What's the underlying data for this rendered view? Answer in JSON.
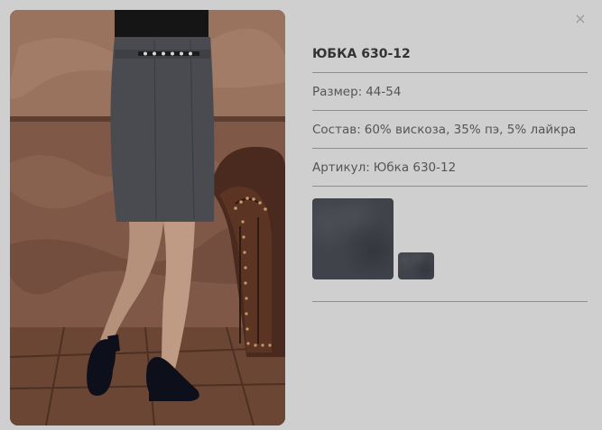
{
  "dialog": {
    "close_label": "×"
  },
  "product": {
    "title": "ЮБКА 630-12",
    "size": {
      "label": "Размер:",
      "value": "44-54"
    },
    "composition": {
      "label": "Состав:",
      "value": "60% вискоза, 35% пэ, 5% лайкра"
    },
    "article": {
      "label": "Артикул:",
      "value": "Юбка 630-12"
    }
  },
  "swatches": {
    "colors": [
      "#41434b",
      "#41434b"
    ]
  },
  "colors": {
    "background": "#cfcfcf",
    "text": "#555555",
    "title": "#333333",
    "divider": "#8e8e8e"
  }
}
